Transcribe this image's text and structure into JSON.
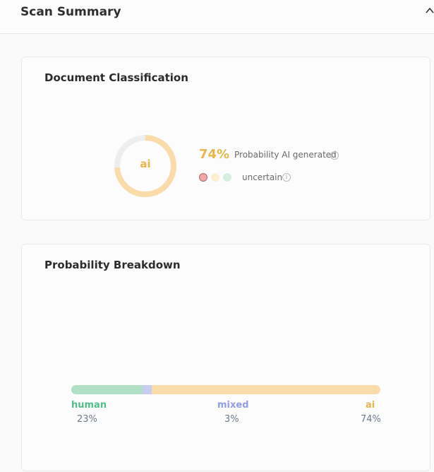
{
  "header": {
    "title": "Scan Summary"
  },
  "classification": {
    "title": "Document Classification",
    "donut_label": "ai",
    "percent": "74%",
    "percent_value": 74,
    "probability_label": "Probability AI generated",
    "certainty_label": "uncertain",
    "colors": {
      "ai": "#e8b54a",
      "ring_track": "#eeeeee",
      "ring_fill": "#f9dcaa"
    }
  },
  "breakdown": {
    "title": "Probability Breakdown",
    "segments": [
      {
        "key": "human",
        "label": "human",
        "value_text": "23%",
        "value": 23,
        "color": "#b1e0c6"
      },
      {
        "key": "mixed",
        "label": "mixed",
        "value_text": "3%",
        "value": 3,
        "color": "#c7cdf0"
      },
      {
        "key": "ai",
        "label": "ai",
        "value_text": "74%",
        "value": 74,
        "color": "#f9dcaa"
      }
    ]
  },
  "icons": {
    "collapse": "chevron-up-icon",
    "info": "info-icon"
  }
}
